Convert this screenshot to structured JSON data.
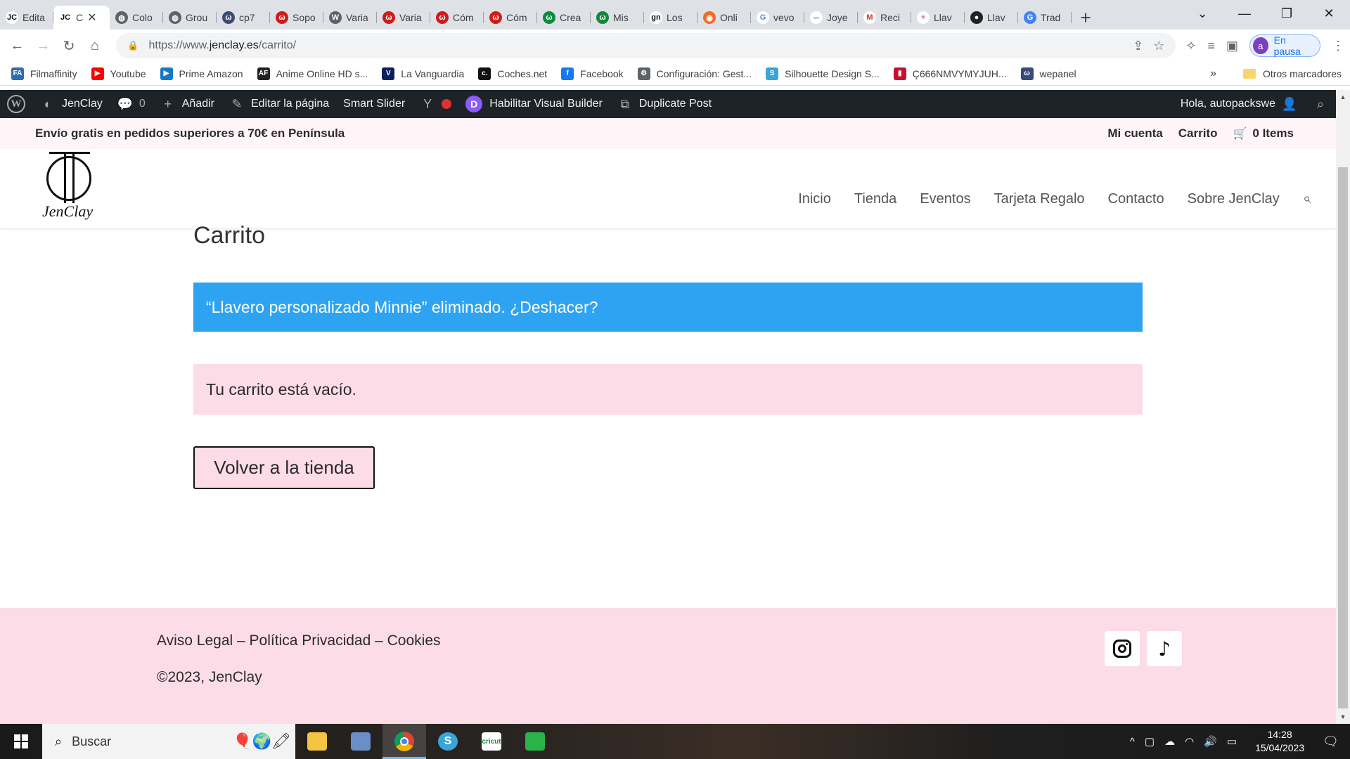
{
  "browser": {
    "tabs": [
      {
        "label": "Edita",
        "icon": "jenclay-icon",
        "color": "#ffffff",
        "fg": "#111111",
        "glyph": "JC"
      },
      {
        "label": "C",
        "icon": "jenclay-icon",
        "color": "#ffffff",
        "fg": "#111111",
        "glyph": "JC",
        "active": true
      },
      {
        "label": "Colo",
        "icon": "globe-icon",
        "color": "#5f6368",
        "fg": "#ffffff",
        "glyph": "◍"
      },
      {
        "label": "Grou",
        "icon": "globe-icon",
        "color": "#5f6368",
        "fg": "#ffffff",
        "glyph": "◍"
      },
      {
        "label": "cp7",
        "icon": "woo-icon",
        "color": "#3c4a7a",
        "fg": "#ffffff",
        "glyph": "ω"
      },
      {
        "label": "Sopo",
        "icon": "woo-icon",
        "color": "#d11a1a",
        "fg": "#ffffff",
        "glyph": "ω"
      },
      {
        "label": "Varia",
        "icon": "wordpress-icon",
        "color": "#5f6368",
        "fg": "#ffffff",
        "glyph": "W"
      },
      {
        "label": "Varia",
        "icon": "woo-icon",
        "color": "#d11a1a",
        "fg": "#ffffff",
        "glyph": "ω"
      },
      {
        "label": "Cóm",
        "icon": "woo-icon",
        "color": "#d11a1a",
        "fg": "#ffffff",
        "glyph": "ω"
      },
      {
        "label": "Cóm",
        "icon": "woo-icon",
        "color": "#d11a1a",
        "fg": "#ffffff",
        "glyph": "ω"
      },
      {
        "label": "Crea",
        "icon": "woo-icon",
        "color": "#0f8a3c",
        "fg": "#ffffff",
        "glyph": "ω"
      },
      {
        "label": "Mis",
        "icon": "woo-icon",
        "color": "#0f8a3c",
        "fg": "#ffffff",
        "glyph": "ω"
      },
      {
        "label": "Los",
        "icon": "gn-icon",
        "color": "#ffffff",
        "fg": "#111111",
        "glyph": "gn"
      },
      {
        "label": "Onli",
        "icon": "online-icon",
        "color": "#f06a28",
        "fg": "#ffffff",
        "glyph": "◉"
      },
      {
        "label": "vevo",
        "icon": "google-icon",
        "color": "#ffffff",
        "fg": "#4285f4",
        "glyph": "G"
      },
      {
        "label": "Joye",
        "icon": "joye-icon",
        "color": "#ffffff",
        "fg": "#888888",
        "glyph": "∽"
      },
      {
        "label": "Reci",
        "icon": "gmail-icon",
        "color": "#ffffff",
        "fg": "#d93025",
        "glyph": "M"
      },
      {
        "label": "Llav",
        "icon": "heart-icon",
        "color": "#ffffff",
        "fg": "#e78fa9",
        "glyph": "♥"
      },
      {
        "label": "Llav",
        "icon": "dark-icon",
        "color": "#222222",
        "fg": "#ffffff",
        "glyph": "●"
      },
      {
        "label": "Trad",
        "icon": "translate-icon",
        "color": "#4285f4",
        "fg": "#ffffff",
        "glyph": "G"
      }
    ],
    "url_prefix": "https://www.",
    "url_domain": "jenclay.es",
    "url_path": "/carrito/",
    "profile_initial": "a",
    "profile_label": "En pausa"
  },
  "bookmarks": {
    "items": [
      {
        "label": "Filmaffinity",
        "icon": "filmaffinity-icon",
        "color": "#2d6db4",
        "glyph": "FA"
      },
      {
        "label": "Youtube",
        "icon": "youtube-icon",
        "color": "#ff0000",
        "glyph": "▶"
      },
      {
        "label": "Prime Amazon",
        "icon": "prime-icon",
        "color": "#1a78c2",
        "glyph": "▶"
      },
      {
        "label": "Anime Online HD s...",
        "icon": "anime-icon",
        "color": "#222222",
        "glyph": "AF"
      },
      {
        "label": "La Vanguardia",
        "icon": "vanguardia-icon",
        "color": "#0b1f5c",
        "glyph": "V"
      },
      {
        "label": "Coches.net",
        "icon": "coches-icon",
        "color": "#111111",
        "glyph": "c."
      },
      {
        "label": "Facebook",
        "icon": "facebook-icon",
        "color": "#1877f2",
        "glyph": "f"
      },
      {
        "label": "Configuración: Gest...",
        "icon": "gear-icon",
        "color": "#5f6368",
        "glyph": "⚙"
      },
      {
        "label": "Silhouette Design S...",
        "icon": "silhouette-icon",
        "color": "#3aa6d8",
        "glyph": "S"
      },
      {
        "label": "Ç666NMVYMYJUH...",
        "icon": "red-bookmark-icon",
        "color": "#c8102e",
        "glyph": "▮"
      },
      {
        "label": "wepanel",
        "icon": "wepanel-icon",
        "color": "#3c4a7a",
        "glyph": "ω"
      }
    ],
    "more": "»",
    "other": "Otros marcadores"
  },
  "wp_admin": {
    "site_name": "JenClay",
    "comments_count": "0",
    "add_label": "Añadir",
    "edit_label": "Editar la página",
    "slider_label": "Smart Slider",
    "visual_builder_label": "Habilitar Visual Builder",
    "duplicate_label": "Duplicate Post",
    "greeting": "Hola, autopackswe"
  },
  "site": {
    "promo": "Envío gratis en pedidos superiores a 70€ en Península",
    "account": "Mi cuenta",
    "cart": "Carrito",
    "items": "0 Items",
    "logo_text": "JenClay",
    "nav": [
      "Inicio",
      "Tienda",
      "Eventos",
      "Tarjeta Regalo",
      "Contacto",
      "Sobre JenClay"
    ]
  },
  "content": {
    "title": "Carrito",
    "removed_notice": "“Llavero personalizado Minnie” eliminado. ¿Deshacer?",
    "empty_notice": "Tu carrito está vacío.",
    "return_button": "Volver a la tienda"
  },
  "footer": {
    "links": "Aviso Legal – Política Privacidad – Cookies",
    "copyright": "©2023,  JenClay"
  },
  "taskbar": {
    "search_placeholder": "Buscar",
    "time": "14:28",
    "date": "15/04/2023"
  },
  "colors": {
    "notice_blue": "#2ea3f2",
    "pink": "#fcdce6",
    "admin_bar": "#1d2327"
  }
}
